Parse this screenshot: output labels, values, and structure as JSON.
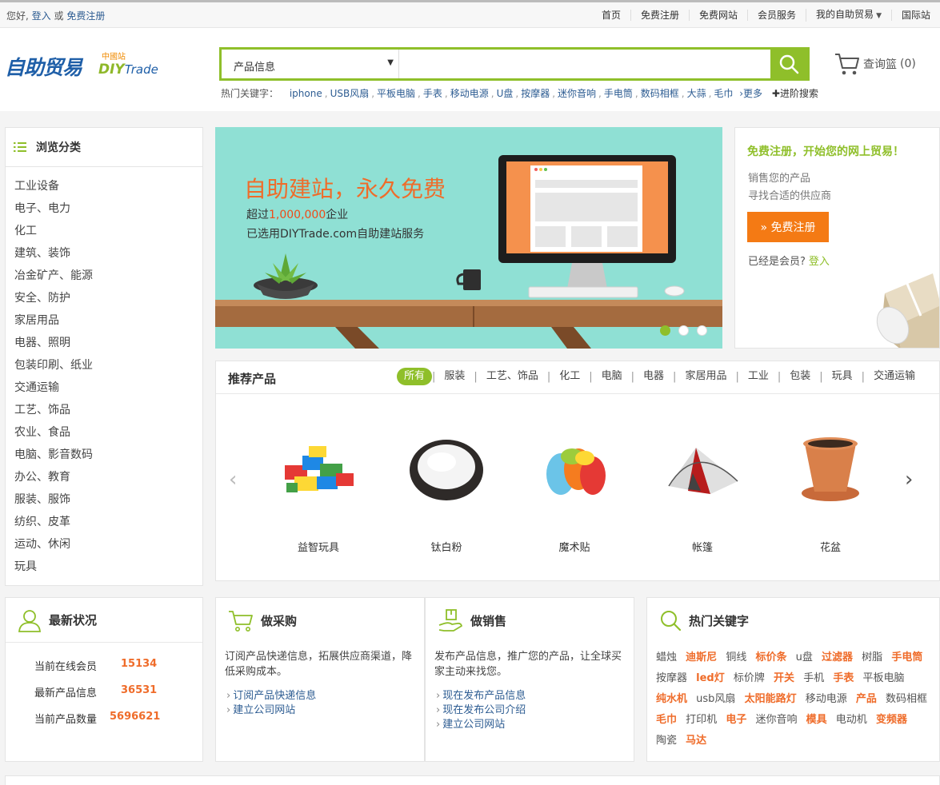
{
  "topbar": {
    "greeting": "您好,",
    "login": "登入",
    "or": "或",
    "register": "免费注册",
    "nav": [
      "首页",
      "免费注册",
      "免费网站",
      "会员服务",
      "我的自助贸易",
      "国际站"
    ]
  },
  "logo": {
    "cn": "自助贸易",
    "zg": "中國站",
    "diy": "DIY",
    "trade": "Trade"
  },
  "search": {
    "category": "产品信息",
    "placeholder": "",
    "hot_label": "热门关键字：",
    "hot_keywords": [
      "iphone",
      "USB风扇",
      "平板电脑",
      "手表",
      "移动电源",
      "U盘",
      "按摩器",
      "迷你音响",
      "手电筒",
      "数码相框",
      "大蒜",
      "毛巾"
    ],
    "more": "›更多",
    "advanced": "进阶搜索"
  },
  "cart": {
    "label": "查询篮",
    "count": "(0)"
  },
  "sidebar": {
    "title": "浏览分类",
    "categories": [
      "工业设备",
      "电子、电力",
      "化工",
      "建筑、装饰",
      "冶金矿产、能源",
      "安全、防护",
      "家居用品",
      "电器、照明",
      "包装印刷、纸业",
      "交通运输",
      "工艺、饰品",
      "农业、食品",
      "电脑、影音数码",
      "办公、教育",
      "服装、服饰",
      "纺织、皮革",
      "运动、休闲",
      "玩具"
    ]
  },
  "banner": {
    "headline": "自助建站，永久免费",
    "line1_pre": "超过",
    "line1_num": "1,000,000",
    "line1_post": "企业",
    "line2": "已选用DIYTrade.com自助建站服务",
    "slides": 3,
    "active_slide": 1
  },
  "register_box": {
    "title": "免费注册，开始您的网上贸易！",
    "line1": "销售您的产品",
    "line2": "寻找合适的供应商",
    "button": "» 免费注册",
    "member": "已经是会员?",
    "login": "登入"
  },
  "recommended": {
    "title": "推荐产品",
    "tabs": [
      "所有",
      "服装",
      "工艺、饰品",
      "化工",
      "电脑",
      "电器",
      "家居用品",
      "工业",
      "包装",
      "玩具",
      "交通运输"
    ],
    "products": [
      "益智玩具",
      "钛白粉",
      "魔术贴",
      "帐篷",
      "花盆"
    ]
  },
  "status": {
    "title": "最新状况",
    "rows": [
      {
        "label": "当前在线会员",
        "value": "15134"
      },
      {
        "label": "最新产品信息",
        "value": "36531"
      },
      {
        "label": "当前产品数量",
        "value": "5696621"
      }
    ]
  },
  "buy": {
    "title": "做采购",
    "desc": "订阅产品快递信息，拓展供应商渠道，降低采购成本。",
    "links": [
      "订阅产品快递信息",
      "建立公司网站"
    ]
  },
  "sell": {
    "title": "做销售",
    "desc": "发布产品信息，推广您的产品，让全球买家主动来找您。",
    "links": [
      "现在发布产品信息",
      "现在发布公司介绍",
      "建立公司网站"
    ]
  },
  "hot": {
    "title": "热门关键字",
    "keywords": [
      {
        "t": "蜡烛",
        "h": false
      },
      {
        "t": "迪斯尼",
        "h": true
      },
      {
        "t": "铜线",
        "h": false
      },
      {
        "t": "标价条",
        "h": true
      },
      {
        "t": "u盘",
        "h": false
      },
      {
        "t": "过滤器",
        "h": true
      },
      {
        "t": "树脂",
        "h": false
      },
      {
        "t": "手电筒",
        "h": true
      },
      {
        "t": "按摩器",
        "h": false
      },
      {
        "t": "led灯",
        "h": true
      },
      {
        "t": "标价牌",
        "h": false
      },
      {
        "t": "开关",
        "h": true
      },
      {
        "t": "手机",
        "h": false
      },
      {
        "t": "手表",
        "h": true
      },
      {
        "t": "平板电脑",
        "h": false
      },
      {
        "t": "纯水机",
        "h": true
      },
      {
        "t": "usb风扇",
        "h": false
      },
      {
        "t": "太阳能路灯",
        "h": true
      },
      {
        "t": "移动电源",
        "h": false
      },
      {
        "t": "产品",
        "h": true
      },
      {
        "t": "数码相框",
        "h": false
      },
      {
        "t": "毛巾",
        "h": true
      },
      {
        "t": "打印机",
        "h": false
      },
      {
        "t": "电子",
        "h": true
      },
      {
        "t": "迷你音响",
        "h": false
      },
      {
        "t": "模具",
        "h": true
      },
      {
        "t": "电动机",
        "h": false
      },
      {
        "t": "变频器",
        "h": true
      },
      {
        "t": "陶瓷",
        "h": false
      },
      {
        "t": "马达",
        "h": true
      }
    ]
  },
  "colors": {
    "accent": "#8fbf2a",
    "orange": "#f47a14",
    "link": "#2d5c92",
    "banner_bg": "#8fe0d4"
  }
}
